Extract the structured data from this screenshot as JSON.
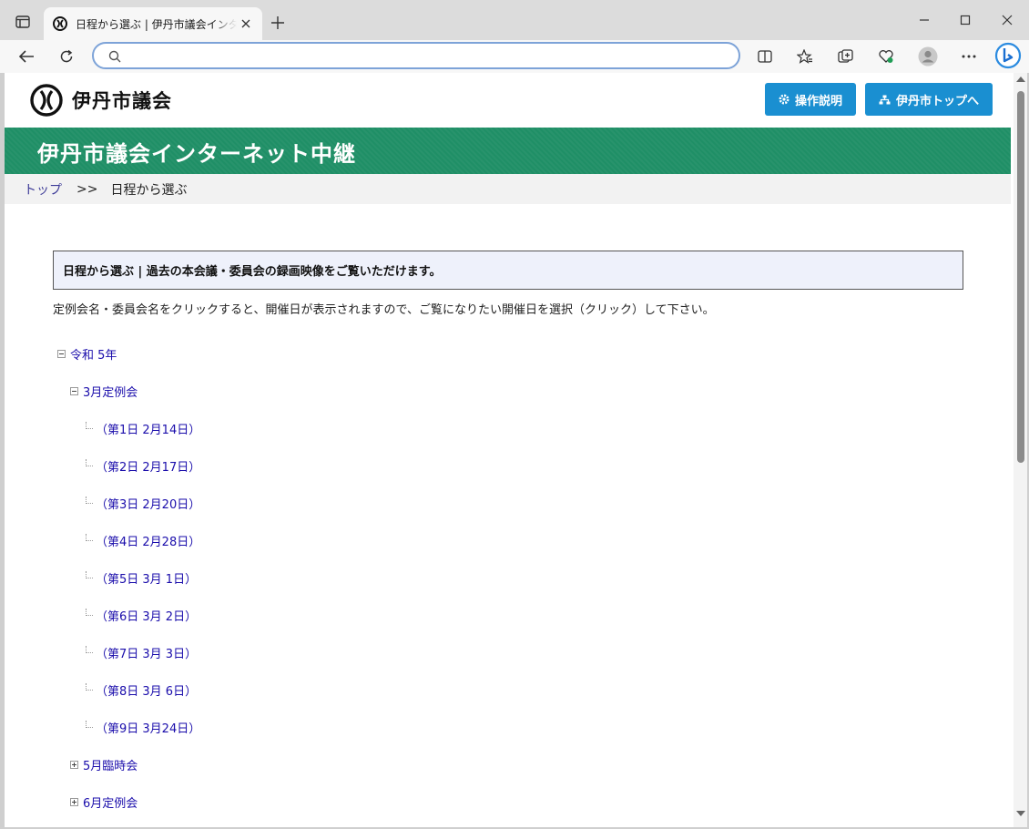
{
  "browser": {
    "tab_title": "日程から選ぶ | 伊丹市議会インターネット中継",
    "address_value": "",
    "icons": {
      "tab_actions": "tab-actions-icon",
      "favicon": "itami-emblem-icon",
      "close": "close-icon",
      "new_tab": "plus-icon",
      "back": "back-arrow-icon",
      "refresh": "refresh-icon",
      "search": "search-icon",
      "split": "split-screen-icon",
      "favorites": "star-icon",
      "collections": "collections-icon",
      "health": "browser-essentials-icon",
      "profile": "profile-icon",
      "more": "more-icon",
      "copilot": "copilot-icon"
    }
  },
  "site": {
    "logo_text": "伊丹市議会",
    "buttons": {
      "manual": "操作説明",
      "city_top": "伊丹市トップへ"
    },
    "banner_title": "伊丹市議会インターネット中継",
    "brand_color": "#1f8f66",
    "button_color": "#1a8fd1"
  },
  "breadcrumb": {
    "home": "トップ",
    "separator": ">>",
    "current": "日程から選ぶ"
  },
  "content": {
    "intro_title": "日程から選ぶ | 過去の本会議・委員会の録画映像をご覧いただけます。",
    "instruction": "定例会名・委員会名をクリックすると、開催日が表示されますので、ご覧になりたい開催日を選択（クリック）して下さい。"
  },
  "tree": {
    "year": "令和 5年",
    "session_open": "3月定例会",
    "days": [
      "（第1日 2月14日）",
      "（第2日 2月17日）",
      "（第3日 2月20日）",
      "（第4日 2月28日）",
      "（第5日 3月 1日）",
      "（第6日 3月 2日）",
      "（第7日 3月 3日）",
      "（第8日 3月 6日）",
      "（第9日 3月24日）"
    ],
    "collapsed_sessions": [
      "5月臨時会",
      "6月定例会"
    ]
  }
}
